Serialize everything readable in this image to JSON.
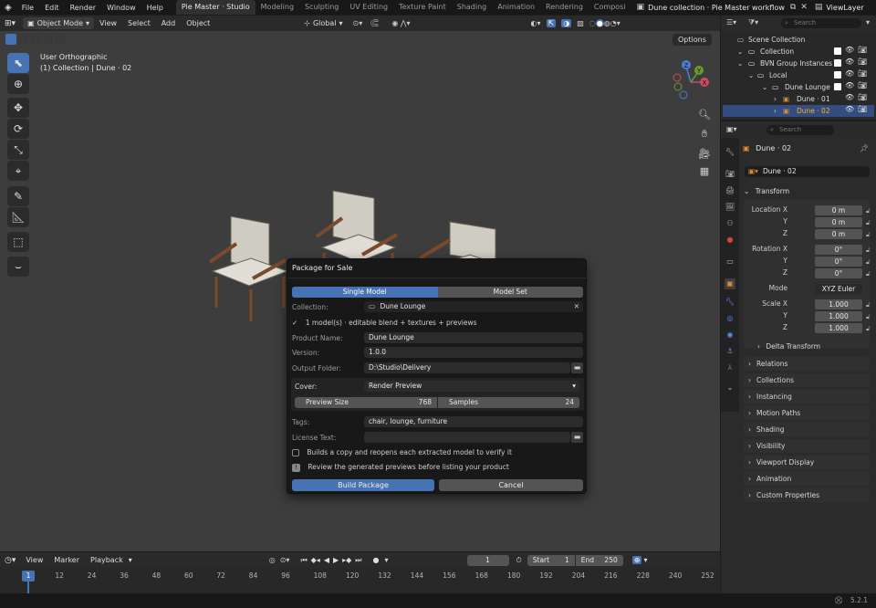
{
  "topbar": {
    "menus": [
      "File",
      "Edit",
      "Render",
      "Window",
      "Help"
    ],
    "workspaces": [
      "Pie Master · Studio",
      "Modeling",
      "Sculpting",
      "UV Editing",
      "Texture Paint",
      "Shading",
      "Animation",
      "Rendering",
      "Composi"
    ],
    "scene_name": "Dune collection · Pie Master workflow",
    "view_layer": "ViewLayer"
  },
  "viewport": {
    "mode": "Object Mode",
    "menus": [
      "View",
      "Select",
      "Add",
      "Object"
    ],
    "orientation": "Global",
    "options": "Options",
    "view_name": "User Orthographic",
    "collection_info": "(1) Collection | Dune · 02",
    "gizmo_axes": [
      "X",
      "Y",
      "Z"
    ]
  },
  "dialog": {
    "title": "Package for Sale",
    "tab_single": "Single Model",
    "tab_set": "Model Set",
    "collection_label": "Collection:",
    "collection_value": "Dune Lounge",
    "check_text": "1 model(s) · editable blend + textures + previews",
    "product_label": "Product Name:",
    "product_value": "Dune Lounge",
    "version_label": "Version:",
    "version_value": "1.0.0",
    "output_label": "Output Folder:",
    "output_value": "D:\\Studio\\Delivery",
    "cover_label": "Cover:",
    "cover_value": "Render Preview",
    "preview_size_label": "Preview Size",
    "preview_size_value": "768",
    "samples_label": "Samples",
    "samples_value": "24",
    "tags_label": "Tags:",
    "tags_value": "chair, lounge, furniture",
    "license_label": "License Text:",
    "license_value": "",
    "verify_text": "Builds a copy and reopens each extracted model to verify it",
    "info_text": "Review the generated previews before listing your product",
    "build_label": "Build Package",
    "cancel_label": "Cancel"
  },
  "outliner": {
    "search_placeholder": "Search",
    "rows": [
      "Scene Collection",
      "Collection",
      "BVN Group Instances",
      "Local",
      "Dune Lounge",
      "Dune · 01",
      "Dune · 02"
    ]
  },
  "properties": {
    "search_placeholder": "Search",
    "object_name": "Dune · 02",
    "data_name": "Dune · 02",
    "transform_label": "Transform",
    "location_label": "Location X",
    "location": [
      "0 m",
      "0 m",
      "0 m"
    ],
    "rotation_label": "Rotation X",
    "rotation": [
      "0°",
      "0°",
      "0°"
    ],
    "mode_label": "Mode",
    "mode_value": "XYZ Euler",
    "scale_label": "Scale X",
    "scale": [
      "1.000",
      "1.000",
      "1.000"
    ],
    "axis_y": "Y",
    "axis_z": "Z",
    "delta": "Delta Transform",
    "panels": [
      "Relations",
      "Collections",
      "Instancing",
      "Motion Paths",
      "Shading",
      "Visibility",
      "Viewport Display",
      "Animation",
      "Custom Properties"
    ]
  },
  "timeline": {
    "menus": [
      "View",
      "Marker",
      "Playback"
    ],
    "current_frame": "1",
    "start_label": "Start",
    "start_value": "1",
    "end_label": "End",
    "end_value": "250",
    "ticks": [
      "1",
      "12",
      "24",
      "36",
      "48",
      "60",
      "72",
      "84",
      "96",
      "108",
      "120",
      "132",
      "144",
      "156",
      "168",
      "180",
      "192",
      "204",
      "216",
      "228",
      "240",
      "252"
    ]
  },
  "status": {
    "version": "5.2.1"
  },
  "colors": {
    "accent": "#4772b3",
    "dialog_bg": "#181818",
    "viewport_bg": "#3d3d3d"
  }
}
